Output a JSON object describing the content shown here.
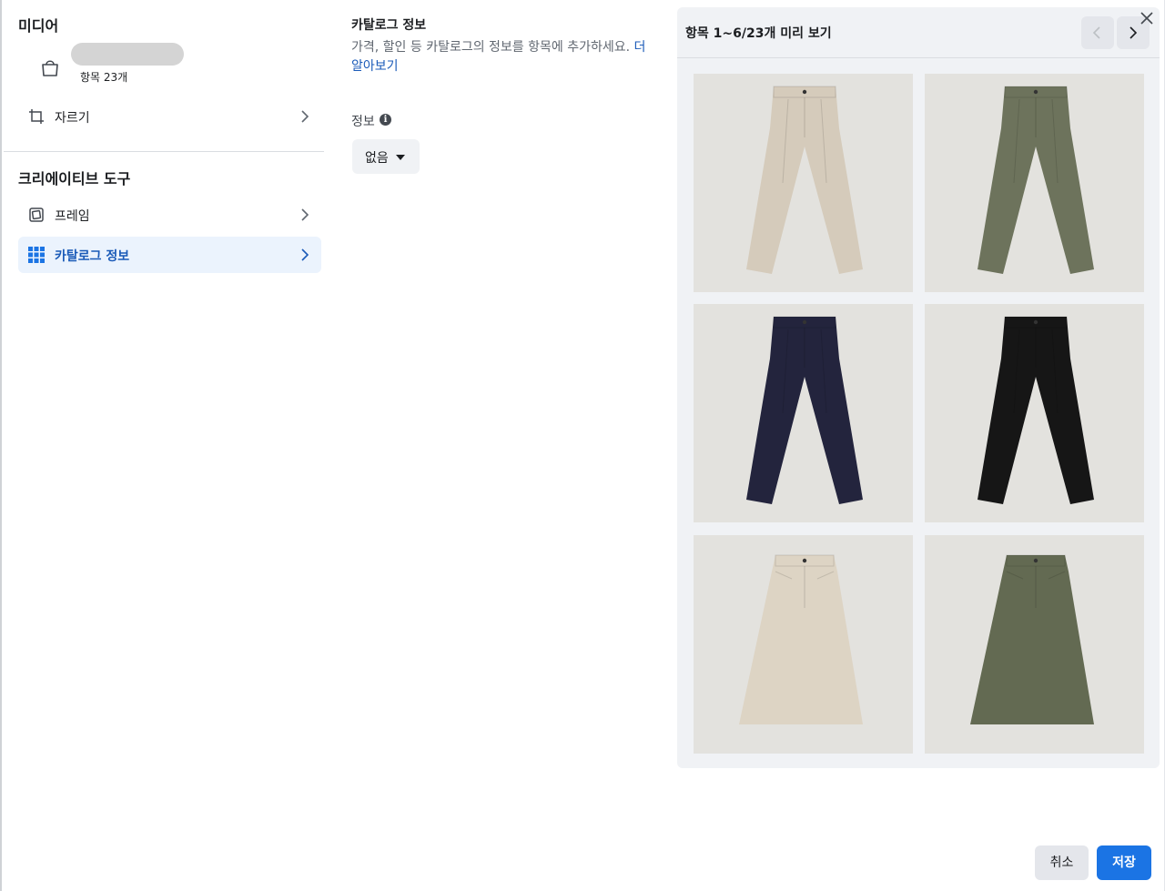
{
  "left": {
    "media_title": "미디어",
    "media_count": "항목 23개",
    "crop_label": "자르기",
    "creative_title": "크리에이티브 도구",
    "frame_label": "프레임",
    "catalog_label": "카탈로그 정보"
  },
  "middle": {
    "title": "카탈로그 정보",
    "description": "가격, 할인 등 카탈로그의 정보를 항목에 추가하세요.",
    "learn_more": "더 알아보기",
    "info_label": "정보",
    "info_value": "없음"
  },
  "preview": {
    "title": "항목 1~6/23개 미리 보기",
    "items": [
      {
        "kind": "pants",
        "color": "#d5cbbb"
      },
      {
        "kind": "pants",
        "color": "#6d735c"
      },
      {
        "kind": "pants",
        "color": "#23243d"
      },
      {
        "kind": "pants",
        "color": "#161616"
      },
      {
        "kind": "skirt",
        "color": "#ddd4c4"
      },
      {
        "kind": "skirt",
        "color": "#636a52"
      }
    ]
  },
  "footer": {
    "cancel_label": "취소",
    "save_label": "저장"
  },
  "colors": {
    "accent": "#1b74e4",
    "link": "#1a5ab8",
    "active_bg": "#ebf3fd"
  }
}
